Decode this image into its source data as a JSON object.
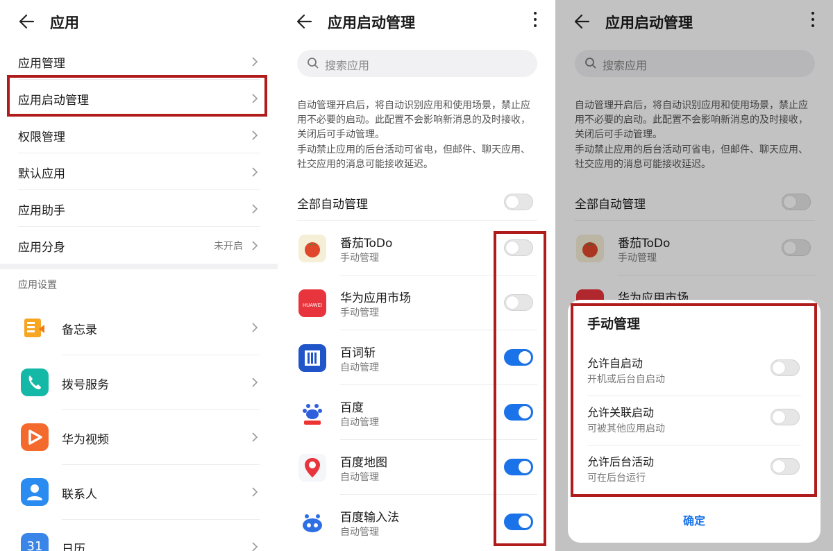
{
  "panel1": {
    "title": "应用",
    "items": [
      {
        "label": "应用管理",
        "value": ""
      },
      {
        "label": "应用启动管理",
        "value": ""
      },
      {
        "label": "权限管理",
        "value": ""
      },
      {
        "label": "默认应用",
        "value": ""
      },
      {
        "label": "应用助手",
        "value": ""
      },
      {
        "label": "应用分身",
        "value": "未开启"
      }
    ],
    "section_title": "应用设置",
    "apps": [
      {
        "label": "备忘录",
        "icon": "memo-icon"
      },
      {
        "label": "拨号服务",
        "icon": "phone-icon"
      },
      {
        "label": "华为视频",
        "icon": "video-play-icon"
      },
      {
        "label": "联系人",
        "icon": "contact-icon"
      },
      {
        "label": "日历",
        "icon": "calendar-icon",
        "icon_text": "31"
      }
    ]
  },
  "panel2": {
    "title": "应用启动管理",
    "search_placeholder": "搜索应用",
    "desc1": "自动管理开启后，将自动识别应用和使用场景，禁止应用不必要的启动。此配置不会影响新消息的及时接收，关闭后可手动管理。",
    "desc2": "手动禁止应用的后台活动可省电，但邮件、聊天应用、社交应用的消息可能接收延迟。",
    "all_auto_label": "全部自动管理",
    "all_auto_on": false,
    "apps": [
      {
        "name": "番茄ToDo",
        "mode": "手动管理",
        "on": false,
        "icon": "tomato-todo-icon"
      },
      {
        "name": "华为应用市场",
        "mode": "手动管理",
        "on": false,
        "icon": "huawei-appgallery-icon",
        "icon_text": "HUAWEI"
      },
      {
        "name": "百词斩",
        "mode": "自动管理",
        "on": true,
        "icon": "baicizhan-icon"
      },
      {
        "name": "百度",
        "mode": "自动管理",
        "on": true,
        "icon": "baidu-paw-icon"
      },
      {
        "name": "百度地图",
        "mode": "自动管理",
        "on": true,
        "icon": "baidu-map-icon"
      },
      {
        "name": "百度输入法",
        "mode": "自动管理",
        "on": true,
        "icon": "baidu-input-icon"
      }
    ]
  },
  "panel3": {
    "title": "应用启动管理",
    "search_placeholder": "搜索应用",
    "desc1": "自动管理开启后，将自动识别应用和使用场景，禁止应用不必要的启动。此配置不会影响新消息的及时接收，关闭后可手动管理。",
    "desc2": "手动禁止应用的后台活动可省电，但邮件、聊天应用、社交应用的消息可能接收延迟。",
    "all_auto_label": "全部自动管理",
    "apps": [
      {
        "name": "番茄ToDo",
        "mode": "手动管理"
      },
      {
        "name": "华为应用市场",
        "mode": ""
      }
    ],
    "sheet": {
      "title": "手动管理",
      "options": [
        {
          "name": "允许自启动",
          "sub": "开机或后台自启动",
          "on": false
        },
        {
          "name": "允许关联启动",
          "sub": "可被其他应用启动",
          "on": false
        },
        {
          "name": "允许后台活动",
          "sub": "可在后台运行",
          "on": false
        }
      ],
      "confirm": "确定"
    }
  },
  "colors": {
    "accent": "#1a73e8",
    "highlight_border": "#b01b1b"
  }
}
